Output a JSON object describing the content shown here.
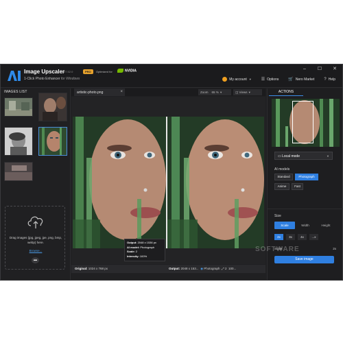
{
  "titlebar": {
    "logo_text": "AI",
    "app_title": "Image Upscaler",
    "version": "27.52.0",
    "pro_badge": "PRO",
    "optimized_for": "Optimized for",
    "nvidia": "NVIDIA",
    "subtitle_prefix": "1-Click Photo Enhancer",
    "subtitle_suffix": "for Windows",
    "account": "My account",
    "options": "Options",
    "market": "Nero Market",
    "help": "Help",
    "window_controls": [
      "–",
      "☐",
      "✕"
    ]
  },
  "left_panel": {
    "title": "IMAGES LIST",
    "drop_text": "Drag images (jpg, jpeg, jpe, png, bmp, webp) here.",
    "browse": "Browse..."
  },
  "center": {
    "tab_name": "artistic-photo.png",
    "zoom_label": "Zoom",
    "zoom_value": "65 %",
    "views_label": "Views",
    "tooltip": {
      "output_label": "Output:",
      "output_value": "2048 x 1536 px",
      "model_label": "AI model:",
      "model_value": "Photograph",
      "scale_label": "Scale:",
      "scale_value": "2",
      "intensity_label": "Intensity:",
      "intensity_value": "100%"
    },
    "status": {
      "original_label": "Original:",
      "original_value": "1024 x 768 px",
      "output_label": "Output:",
      "output_value": "2048 x 153...",
      "model": "Photograph",
      "scale": "2",
      "intensity": "100..."
    }
  },
  "right_panel": {
    "tab": "ACTIONS",
    "mode": "Local mode",
    "models_label": "AI models",
    "models": [
      "Standard",
      "Photograph",
      "Anime",
      "Fast"
    ],
    "selected_model": "Photograph",
    "size_label": "Size",
    "size_modes": [
      "Scale",
      "Width",
      "Height"
    ],
    "selected_size_mode": "Scale",
    "scales": [
      "2x",
      "3x",
      "4x",
      "...x"
    ],
    "selected_scale": "2x",
    "scale_label": "Scale:",
    "scale_value": "2x",
    "save_button": "Save image"
  },
  "watermark": "SOFTWARE",
  "colors": {
    "accent": "#2f7fe0",
    "pro": "#e6a12c",
    "nvidia": "#76b900",
    "window_bg": "#202022"
  }
}
